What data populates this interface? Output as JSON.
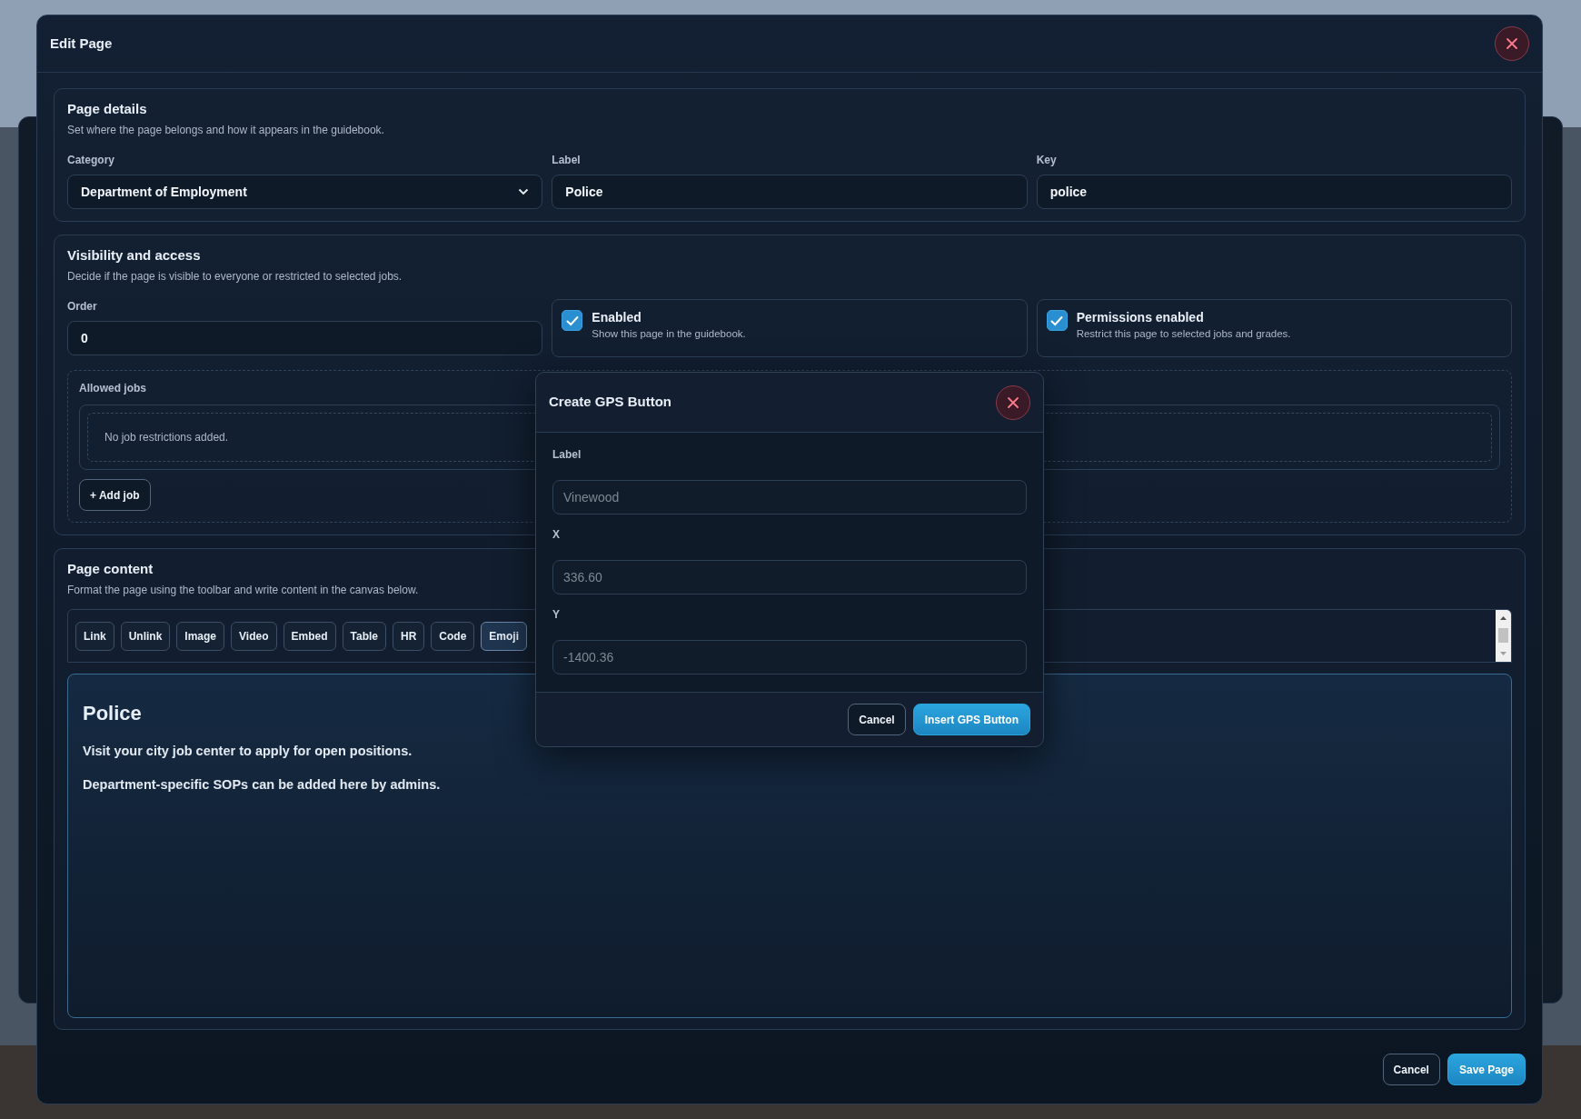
{
  "dialog": {
    "title": "Edit Page"
  },
  "page_details": {
    "title": "Page details",
    "subtitle": "Set where the page belongs and how it appears in the guidebook.",
    "fields": [
      {
        "label": "Category",
        "value": "Department of Employment",
        "kind": "select"
      },
      {
        "label": "Label",
        "value": "Police",
        "kind": "text"
      },
      {
        "label": "Key",
        "value": "police",
        "kind": "text"
      }
    ]
  },
  "visibility": {
    "title": "Visibility and access",
    "subtitle": "Decide if the page is visible to everyone or restricted to selected jobs.",
    "order": {
      "label": "Order",
      "value": "0"
    },
    "toggles": [
      {
        "title": "Enabled",
        "description": "Show this page in the guidebook.",
        "checked": true
      },
      {
        "title": "Permissions enabled",
        "description": "Restrict this page to selected jobs and grades.",
        "checked": true
      }
    ],
    "allowed_jobs": {
      "label": "Allowed jobs",
      "empty_text": "No job restrictions added.",
      "add_button": "+ Add job"
    }
  },
  "page_content": {
    "title": "Page content",
    "subtitle": "Format the page using the toolbar and write content in the canvas below.",
    "toolbar": [
      {
        "label": "Link",
        "active": false
      },
      {
        "label": "Unlink",
        "active": false
      },
      {
        "label": "Image",
        "active": false
      },
      {
        "label": "Video",
        "active": false
      },
      {
        "label": "Embed",
        "active": false
      },
      {
        "label": "Table",
        "active": false
      },
      {
        "label": "HR",
        "active": false
      },
      {
        "label": "Code",
        "active": false
      },
      {
        "label": "Emoji",
        "active": true
      }
    ],
    "editor": {
      "heading": "Police",
      "paragraphs": [
        "Visit your city job center to apply for open positions.",
        "Department-specific SOPs can be added here by admins."
      ]
    }
  },
  "footer_buttons": [
    {
      "label": "Cancel",
      "kind": "secondary"
    },
    {
      "label": "Save Page",
      "kind": "primary"
    }
  ],
  "gps_modal": {
    "title": "Create GPS Button",
    "fields": [
      {
        "label": "Label",
        "placeholder": "Vinewood"
      },
      {
        "label": "X",
        "placeholder": "336.60"
      },
      {
        "label": "Y",
        "placeholder": "-1400.36"
      }
    ],
    "buttons": [
      {
        "label": "Cancel",
        "kind": "secondary"
      },
      {
        "label": "Insert GPS Button",
        "kind": "primary"
      }
    ]
  }
}
